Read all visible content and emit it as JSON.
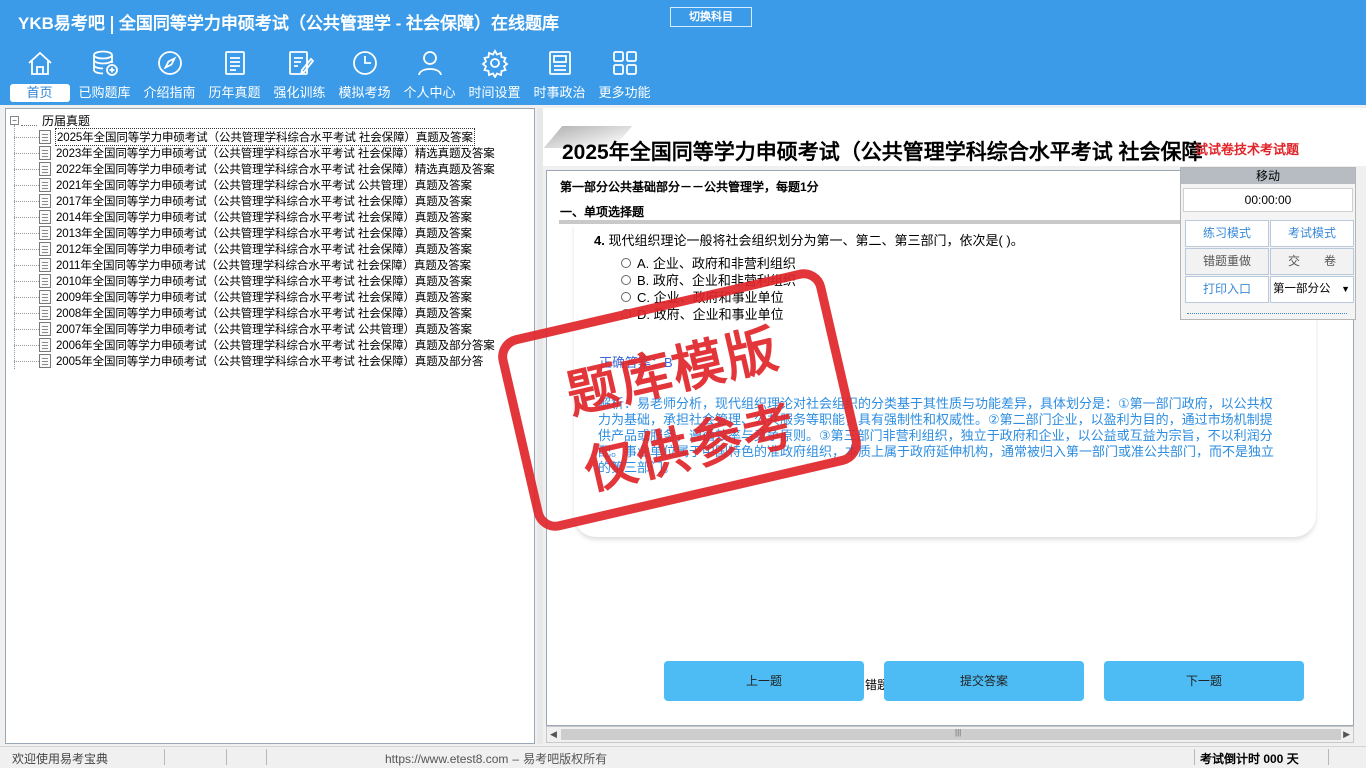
{
  "header": {
    "brand": "YKB易考吧",
    "title": "全国同等学力申硕考试（公共管理学 - 社会保障）在线题库",
    "switch_label": "切换科目"
  },
  "nav": [
    {
      "label": "首页",
      "icon": "home-icon",
      "active": true
    },
    {
      "label": "已购题库",
      "icon": "database-icon"
    },
    {
      "label": "介绍指南",
      "icon": "compass-icon"
    },
    {
      "label": "历年真题",
      "icon": "list-icon"
    },
    {
      "label": "强化训练",
      "icon": "edit-icon"
    },
    {
      "label": "模拟考场",
      "icon": "clock-icon"
    },
    {
      "label": "个人中心",
      "icon": "user-icon"
    },
    {
      "label": "时间设置",
      "icon": "gear-icon"
    },
    {
      "label": "时事政治",
      "icon": "news-icon"
    },
    {
      "label": "更多功能",
      "icon": "grid-icon"
    }
  ],
  "tree": {
    "root": "历届真题",
    "items": [
      "2025年全国同等学力申硕考试（公共管理学科综合水平考试 社会保障）真题及答案",
      "2023年全国同等学力申硕考试（公共管理学科综合水平考试 社会保障）精选真题及答案",
      "2022年全国同等学力申硕考试（公共管理学科综合水平考试 社会保障）精选真题及答案",
      "2021年全国同等学力申硕考试（公共管理学科综合水平考试 公共管理）真题及答案",
      "2017年全国同等学力申硕考试（公共管理学科综合水平考试 社会保障）真题及答案",
      "2014年全国同等学力申硕考试（公共管理学科综合水平考试 社会保障）真题及答案",
      "2013年全国同等学力申硕考试（公共管理学科综合水平考试 社会保障）真题及答案",
      "2012年全国同等学力申硕考试（公共管理学科综合水平考试 社会保障）真题及答案",
      "2011年全国同等学力申硕考试（公共管理学科综合水平考试 社会保障）真题及答案",
      "2010年全国同等学力申硕考试（公共管理学科综合水平考试 社会保障）真题及答案",
      "2009年全国同等学力申硕考试（公共管理学科综合水平考试 社会保障）真题及答案",
      "2008年全国同等学力申硕考试（公共管理学科综合水平考试 社会保障）真题及答案",
      "2007年全国同等学力申硕考试（公共管理学科综合水平考试 公共管理）真题及答案",
      "2006年全国同等学力申硕考试（公共管理学科综合水平考试 社会保障）真题及部分答案",
      "2005年全国同等学力申硕考试（公共管理学科综合水平考试 社会保障）真题及部分答"
    ]
  },
  "exam": {
    "title": "2025年全国同等学力申硕考试（公共管理学科综合水平考试 社会保障",
    "subtitle": "试试卷技术考试题",
    "part": "第一部分公共基础部分－－公共管理学，每题1分",
    "section": "一、单项选择题",
    "question_num": "4.",
    "question": "现代组织理论一般将社会组织划分为第一、第二、第三部门，依次是( )。",
    "options": [
      "A. 企业、政府和非营利组织",
      "B. 政府、企业和非营利组织",
      "C. 企业、政府和事业单位",
      "D. 政府、企业和事业单位"
    ],
    "answer": "正确答案：B",
    "analysis": "解析：易老师分析，现代组织理论对社会组织的分类基于其性质与功能差异，具体划分是：①第一部门政府，以公共权力为基础，承担社会管理、公共服务等职能，具有强制性和权威性。②第二部门企业，以盈利为目的，通过市场机制提供产品或服务，遵循效率与竞争原则。③第三部门非营利组织，独立于政府和企业，以公益或互益为宗旨，不以利润分配。事业单位属于中国特色的准政府组织，本质上属于政府延伸机构，通常被归入第一部门或准公共部门，而不是独立的第三部门。",
    "prev": "上一题",
    "submit": "提交答案",
    "next": "下一题",
    "wrong_note": "错题"
  },
  "control": {
    "move": "移动",
    "timer": "00:00:00",
    "practice": "练习模式",
    "exam_mode": "考试模式",
    "redo": "错题重做",
    "hand_in": "交　　卷",
    "print": "打印入口",
    "part_select": "第一部分公"
  },
  "stamp": {
    "line1": "题库模版",
    "line2": "仅供参考"
  },
  "status": {
    "welcome": "欢迎使用易考宝典",
    "url": "https://www.etest8.com",
    "copyright": "易考吧版权所有",
    "countdown": "考试倒计时 000 天"
  },
  "colors": {
    "header": "#3b9be8",
    "button": "#4dbcf4",
    "stamp": "#e0262b",
    "analysis": "#2c8de0"
  }
}
